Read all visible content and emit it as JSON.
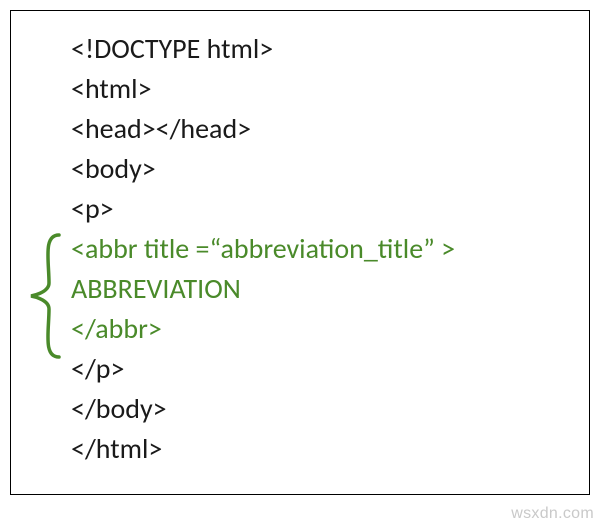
{
  "code": {
    "l1": "<!DOCTYPE html>",
    "l2": "<html>",
    "l3": "<head></head>",
    "l4": "<body>",
    "l5": "<p>",
    "l6": "<abbr title =“abbreviation_title” >",
    "l7": "ABBREVIATION",
    "l8": "</abbr>",
    "l9": "</p>",
    "l10": "</body>",
    "l11": "</html>"
  },
  "watermark": "wsxdn.com"
}
